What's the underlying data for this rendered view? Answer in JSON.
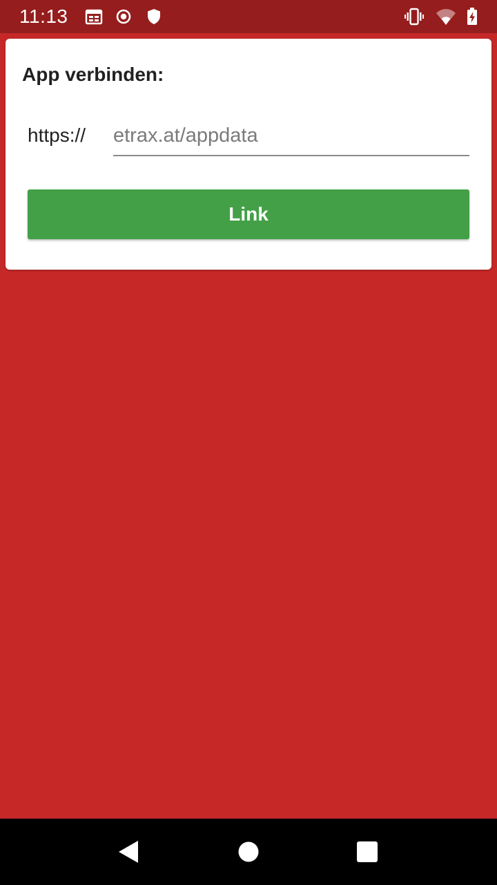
{
  "status_bar": {
    "time": "11:13",
    "left_icons": [
      "calendar-icon",
      "record-icon",
      "shield-icon"
    ],
    "right_icons": [
      "vibrate-icon",
      "wifi-icon",
      "battery-charging-icon"
    ]
  },
  "connect_card": {
    "title": "App verbinden:",
    "url_prefix": "https://",
    "url_input": {
      "value": "",
      "placeholder": "etrax.at/appdata"
    },
    "link_button_label": "Link",
    "button_color": "#43a047"
  },
  "colors": {
    "background": "#c62828",
    "status_bar": "#951d1d",
    "card": "#ffffff"
  },
  "nav_bar": {
    "buttons": [
      "back-icon",
      "home-icon",
      "recents-icon"
    ]
  }
}
